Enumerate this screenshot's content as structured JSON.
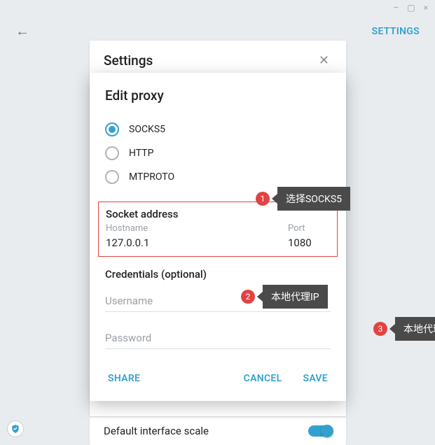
{
  "window": {
    "min": "–",
    "max": "▢",
    "close": "×"
  },
  "header": {
    "settings": "SETTINGS"
  },
  "settings_card": {
    "title": "Settings"
  },
  "bottom": {
    "label": "Default interface scale"
  },
  "modal": {
    "title": "Edit proxy",
    "proxy_types": {
      "socks5": "SOCKS5",
      "http": "HTTP",
      "mtproto": "MTPROTO"
    },
    "socket": {
      "title": "Socket address",
      "hostname_label": "Hostname",
      "hostname_value": "127.0.0.1",
      "port_label": "Port",
      "port_value": "1080"
    },
    "credentials": {
      "title": "Credentials (optional)",
      "username_placeholder": "Username",
      "password_placeholder": "Password"
    },
    "buttons": {
      "share": "SHARE",
      "cancel": "CANCEL",
      "save": "SAVE"
    }
  },
  "callouts": {
    "c1": {
      "num": "1",
      "text": "选择SOCKS5"
    },
    "c2": {
      "num": "2",
      "text": "本地代理IP"
    },
    "c3": {
      "num": "3",
      "text": "本地代理默认端口"
    }
  }
}
